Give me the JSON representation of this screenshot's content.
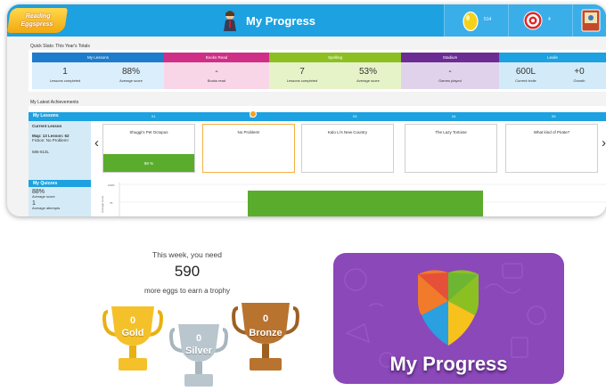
{
  "header": {
    "logo_text": "Reading Eggspress",
    "title": "My Progress",
    "eggs": "514",
    "targets": "4"
  },
  "quick_stats": {
    "label": "Quick Stats: This Year's Totals",
    "columns": [
      {
        "name": "My Lessons",
        "color": "#1d7ccb",
        "bg": "#dbeefb",
        "cells": [
          {
            "value": "1",
            "label": "Lessons completed"
          },
          {
            "value": "88%",
            "label": "Average score"
          }
        ]
      },
      {
        "name": "Books Read",
        "color": "#cf2f86",
        "bg": "#f8d6e8",
        "cells": [
          {
            "value": "-",
            "label": "Books read"
          }
        ]
      },
      {
        "name": "Spelling",
        "color": "#8cc022",
        "bg": "#e6f3c8",
        "cells": [
          {
            "value": "7",
            "label": "Lessons completed"
          },
          {
            "value": "53%",
            "label": "Average score"
          }
        ]
      },
      {
        "name": "Stadium",
        "color": "#6b2c93",
        "bg": "#e1d2ec",
        "cells": [
          {
            "value": "-",
            "label": "Games played"
          }
        ]
      },
      {
        "name": "Lexile",
        "color": "#1da1e0",
        "bg": "#d3ebf8",
        "cells": [
          {
            "value": "600L",
            "label": "Current lexile"
          },
          {
            "value": "+0",
            "label": "Growth"
          }
        ]
      }
    ]
  },
  "achievements": {
    "label": "My Latest Achievements",
    "lessons_title": "My Lessons",
    "column_numbers": [
      "01",
      "02",
      "03",
      "04",
      "05"
    ],
    "current_lesson": {
      "heading": "Current Lesson",
      "map_line": "Map: 13 Lesson: 62",
      "fiction_line": "Fiction: No Problem!",
      "lexile_line": "585-613L"
    },
    "cards": [
      {
        "title": "Shuggi's Pet Octopus",
        "score": "88 %",
        "highlighted": false
      },
      {
        "title": "No Problem!",
        "score": "",
        "highlighted": true
      },
      {
        "title": "Kalo Li's New Country",
        "score": "",
        "highlighted": false
      },
      {
        "title": "The Lazy Tortoise",
        "score": "",
        "highlighted": false
      },
      {
        "title": "What kind of Pirate?",
        "score": "",
        "highlighted": false
      }
    ]
  },
  "quizzes": {
    "title": "My Quizzes",
    "avg_score": "88%",
    "avg_score_label": "Average score",
    "attempts": "1",
    "attempts_label": "Average attempts",
    "y_label": "Average score",
    "y_ticks": [
      "100%",
      "75"
    ],
    "bar_value": 88
  },
  "trophies": {
    "week_line": "This week, you need",
    "eggs_needed": "590",
    "more_line": "more eggs to earn a trophy",
    "items": [
      {
        "count": "0",
        "name": "Gold",
        "color": "#f5c12a"
      },
      {
        "count": "0",
        "name": "Silver",
        "color": "#b9c6cd"
      },
      {
        "count": "0",
        "name": "Bronze",
        "color": "#b8732f"
      }
    ]
  },
  "banner": {
    "title": "My Progress",
    "bg_color": "#8b48b9"
  }
}
